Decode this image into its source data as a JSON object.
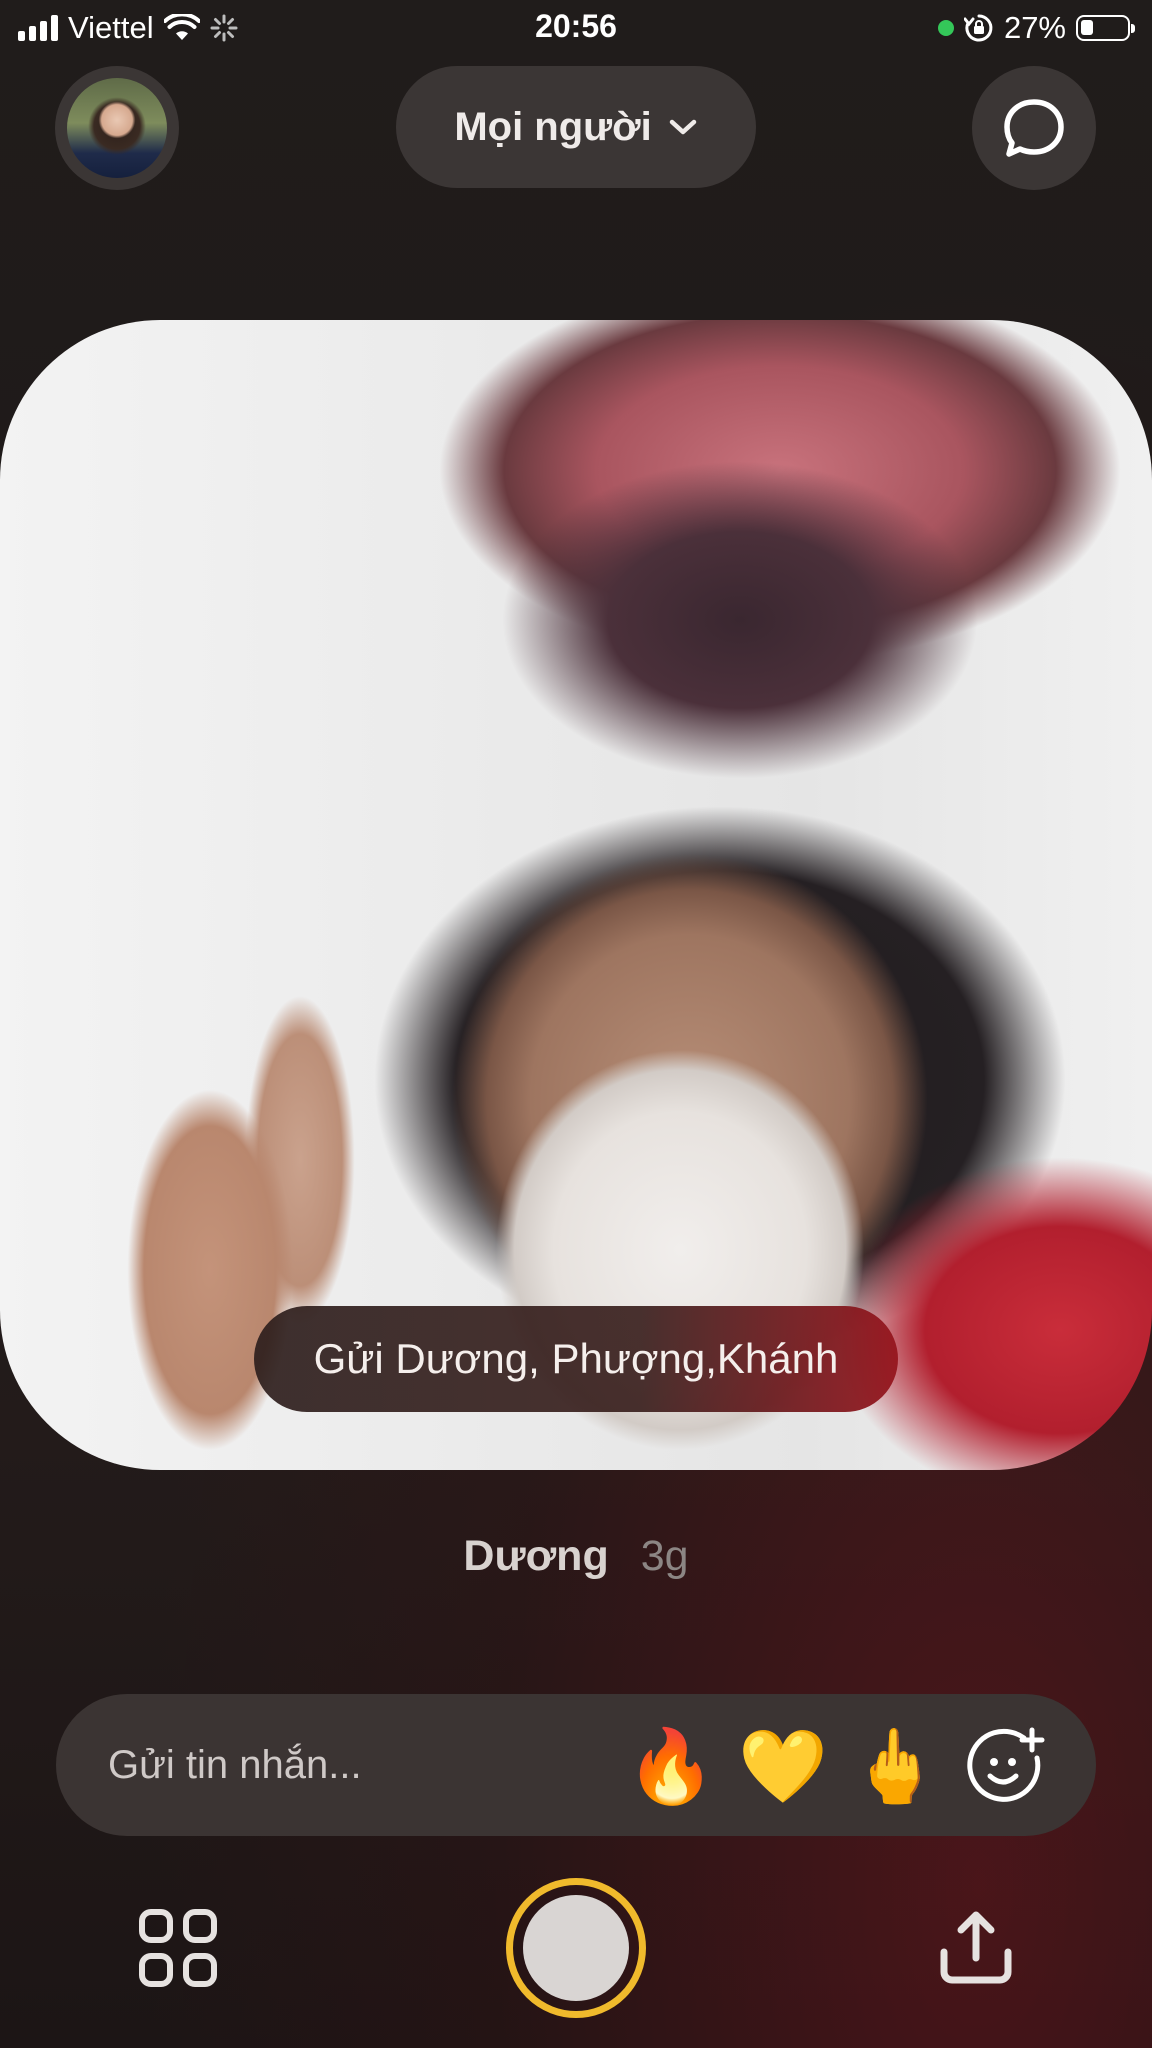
{
  "status_bar": {
    "carrier": "Viettel",
    "time": "20:56",
    "battery_percent": "27%",
    "battery_level": 0.27,
    "icons": [
      "signal-icon",
      "wifi-icon",
      "loading-icon",
      "recording-dot",
      "orientation-lock-icon",
      "battery-icon"
    ]
  },
  "header": {
    "audience_label": "Mọi người",
    "avatar_icon": "profile-avatar",
    "chevron_icon": "chevron-down-icon",
    "chat_icon": "chat-bubble-icon"
  },
  "photo": {
    "caption": "Gửi Dương, Phượng,Khánh"
  },
  "sender": {
    "name": "Dương",
    "time_ago": "3g"
  },
  "message_bar": {
    "placeholder": "Gửi tin nhắn...",
    "reactions": [
      "🔥",
      "💛",
      "🖕"
    ],
    "add_reaction_icon": "add-emoji-icon"
  },
  "bottom_bar": {
    "left_icon": "grid-icon",
    "center_icon": "shutter-button",
    "right_icon": "share-icon",
    "accent_color": "#f0ba2c"
  }
}
